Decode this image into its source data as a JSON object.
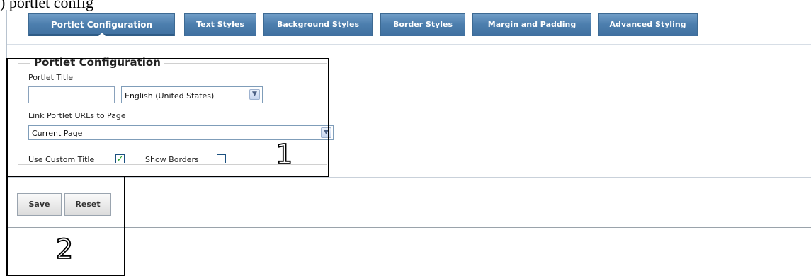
{
  "caption_fragment": ") portlet config",
  "tabs": [
    {
      "label": "Portlet Configuration",
      "active": true
    },
    {
      "label": "Text Styles",
      "active": false
    },
    {
      "label": "Background Styles",
      "active": false
    },
    {
      "label": "Border Styles",
      "active": false
    },
    {
      "label": "Margin and Padding",
      "active": false
    },
    {
      "label": "Advanced Styling",
      "active": false
    }
  ],
  "form": {
    "legend": "Portlet Configuration",
    "portlet_title_label": "Portlet Title",
    "portlet_title_value": "",
    "language_value": "English (United States)",
    "link_urls_label": "Link Portlet URLs to Page",
    "link_urls_value": "Current Page",
    "use_custom_title_label": "Use Custom Title",
    "use_custom_title_checked": true,
    "show_borders_label": "Show Borders",
    "show_borders_checked": false
  },
  "buttons": {
    "save": "Save",
    "reset": "Reset"
  },
  "callouts": [
    "1",
    "2"
  ],
  "colors": {
    "tab": "#4d7fae",
    "tab_border": "#3d6a93",
    "check": "#21a121"
  }
}
